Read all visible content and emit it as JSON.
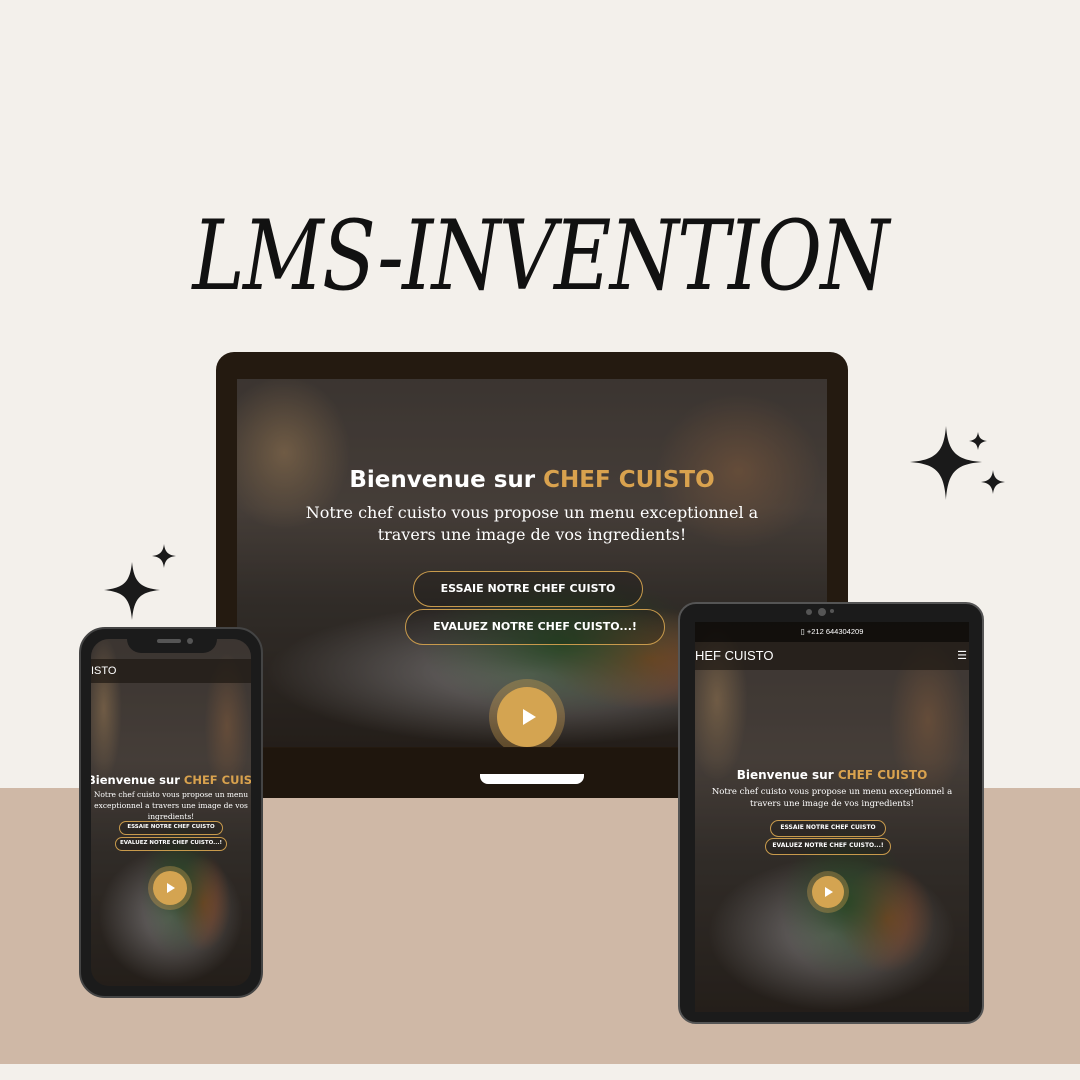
{
  "brand": {
    "title": "LMS-INVENTION"
  },
  "site": {
    "welcome_prefix": "Bienvenue sur",
    "welcome_brand": "CHEF CUISTO",
    "intro": "Notre chef cuisto vous propose un menu exceptionnel a travers une image de vos ingredients!",
    "cta_try": "ESSAIE NOTRE CHEF CUISTO",
    "cta_rate": "EVALUEZ NOTRE CHEF CUISTO...!",
    "phone_number": "+212 644304209",
    "nav_brand_tablet": "HEF CUISTO",
    "nav_brand_phone": "ISTO",
    "menu_icon": "☰"
  },
  "colors": {
    "accent": "#d9a24e",
    "background": "#f3f0eb",
    "floor": "#cfb8a6"
  },
  "icons": [
    "sparkle-icon",
    "play-icon",
    "phone-icon",
    "menu-icon"
  ]
}
